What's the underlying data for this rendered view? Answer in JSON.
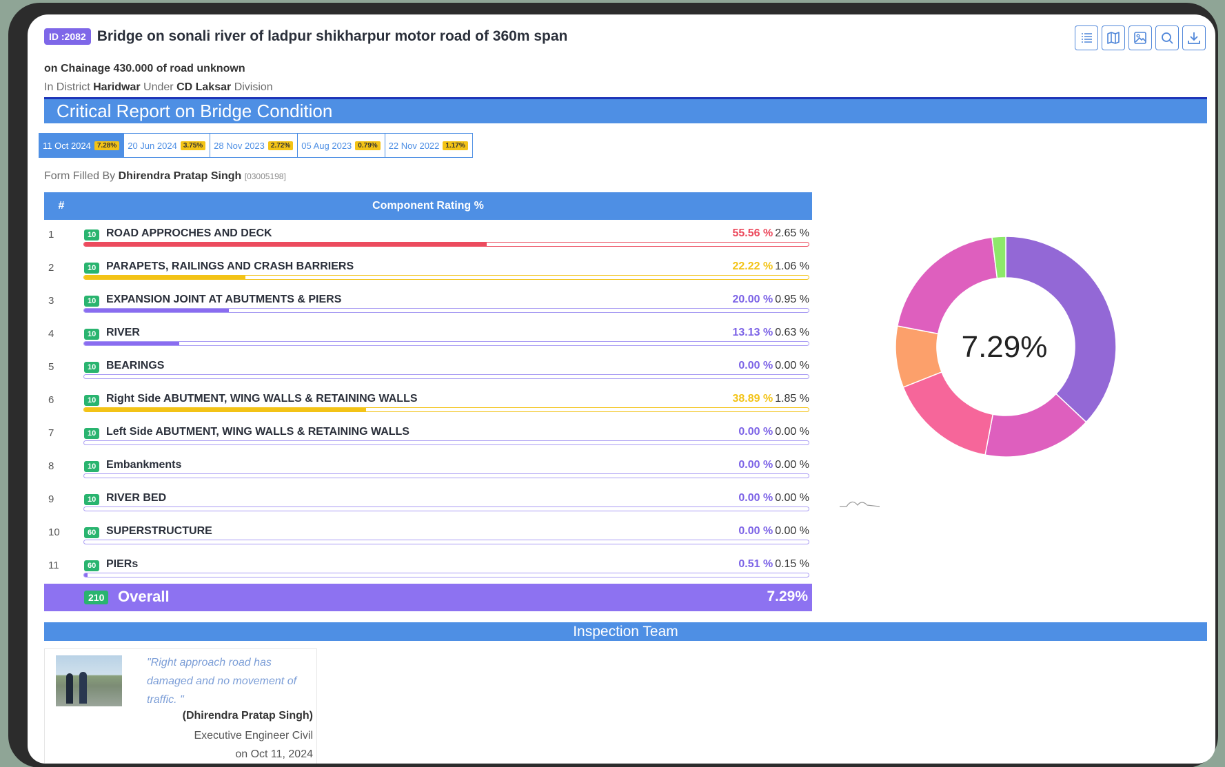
{
  "header": {
    "id_badge": "ID :2082",
    "title": "Bridge on sonali river of ladpur shikharpur motor road of 360m span",
    "chainage": "on Chainage 430.000 of road unknown",
    "district_prefix": "In District",
    "district": "Haridwar",
    "under_text": "Under",
    "division": "CD Laksar",
    "division_suffix": "Division"
  },
  "toolbar": {
    "icons": [
      "list-icon",
      "map-icon",
      "image-icon",
      "search-icon",
      "download-icon"
    ]
  },
  "report_title": "Critical Report on Bridge Condition",
  "tabs": [
    {
      "date": "11 Oct 2024",
      "pct": "7.28%",
      "active": true
    },
    {
      "date": "20 Jun 2024",
      "pct": "3.75%",
      "active": false
    },
    {
      "date": "28 Nov 2023",
      "pct": "2.72%",
      "active": false
    },
    {
      "date": "05 Aug 2023",
      "pct": "0.79%",
      "active": false
    },
    {
      "date": "22 Nov 2022",
      "pct": "1.17%",
      "active": false
    }
  ],
  "form_filled": {
    "label": "Form Filled By",
    "name": "Dhirendra Pratap Singh",
    "code": "[03005198]"
  },
  "table": {
    "col_num": "#",
    "col_title": "Component Rating %",
    "rows": [
      {
        "num": "1",
        "badge": "10",
        "name": "ROAD APPROCHES AND DECK",
        "p1": "55.56 %",
        "p2": "2.65 %",
        "level": 0.5556,
        "color": "#ec4b5e"
      },
      {
        "num": "2",
        "badge": "10",
        "name": "PARAPETS, RAILINGS AND CRASH BARRIERS",
        "p1": "22.22 %",
        "p2": "1.06 %",
        "level": 0.2222,
        "color": "#f3c316"
      },
      {
        "num": "3",
        "badge": "10",
        "name": "EXPANSION JOINT AT ABUTMENTS & PIERS",
        "p1": "20.00 %",
        "p2": "0.95 %",
        "level": 0.2,
        "color": "#8a6cf0"
      },
      {
        "num": "4",
        "badge": "10",
        "name": "RIVER",
        "p1": "13.13 %",
        "p2": "0.63 %",
        "level": 0.1313,
        "color": "#8a6cf0"
      },
      {
        "num": "5",
        "badge": "10",
        "name": "BEARINGS",
        "p1": "0.00 %",
        "p2": "0.00 %",
        "level": 0,
        "color": "#8a6cf0"
      },
      {
        "num": "6",
        "badge": "10",
        "name": "Right Side ABUTMENT, WING WALLS & RETAINING WALLS",
        "p1": "38.89 %",
        "p2": "1.85 %",
        "level": 0.3889,
        "color": "#f3c316"
      },
      {
        "num": "7",
        "badge": "10",
        "name": "Left Side ABUTMENT, WING WALLS & RETAINING WALLS",
        "p1": "0.00 %",
        "p2": "0.00 %",
        "level": 0,
        "color": "#8a6cf0"
      },
      {
        "num": "8",
        "badge": "10",
        "name": "Embankments",
        "p1": "0.00 %",
        "p2": "0.00 %",
        "level": 0,
        "color": "#8a6cf0"
      },
      {
        "num": "9",
        "badge": "10",
        "name": "RIVER BED",
        "p1": "0.00 %",
        "p2": "0.00 %",
        "level": 0,
        "color": "#8a6cf0"
      },
      {
        "num": "10",
        "badge": "60",
        "name": "SUPERSTRUCTURE",
        "p1": "0.00 %",
        "p2": "0.00 %",
        "level": 0,
        "color": "#8a6cf0"
      },
      {
        "num": "11",
        "badge": "60",
        "name": "PIERs",
        "p1": "0.51 %",
        "p2": "0.15 %",
        "level": 0.0051,
        "color": "#8a6cf0"
      }
    ],
    "overall": {
      "badge": "210",
      "label": "Overall",
      "value": "7.29%"
    }
  },
  "donut": {
    "center_label": "7.29%",
    "segments": [
      {
        "fraction": 0.37,
        "color": "#9368d6"
      },
      {
        "fraction": 0.16,
        "color": "#de5fbe"
      },
      {
        "fraction": 0.16,
        "color": "#f6669a"
      },
      {
        "fraction": 0.09,
        "color": "#fca06b"
      },
      {
        "fraction": 0.2,
        "color": "#de5fbe"
      },
      {
        "fraction": 0.02,
        "color": "#8de86a"
      }
    ]
  },
  "team": {
    "title": "Inspection Team",
    "quote": "\"Right approach road has damaged and no movement of traffic. \"",
    "name": "(Dhirendra Pratap Singh)",
    "role": "Executive Engineer Civil",
    "date": "on Oct 11, 2024"
  },
  "colors": {
    "accent": "#4e8fe4",
    "overall": "#8d72f1",
    "badge": "#29b46f",
    "id_badge": "#7e67e8"
  }
}
